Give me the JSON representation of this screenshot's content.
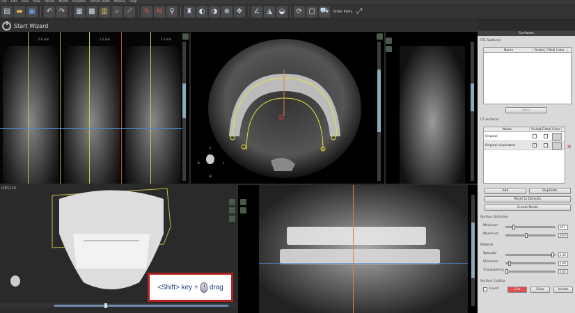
{
  "menu": [
    "File",
    "Edit",
    "Tools",
    "View",
    "Panels",
    "Model",
    "Implants",
    "Virtual Teeth",
    "Module",
    "Help"
  ],
  "toolbar": {
    "icons": [
      "new-file-icon",
      "open-folder-icon",
      "save-icon",
      "undo-icon",
      "redo-icon",
      "layout-icon",
      "grid-icon",
      "note-icon",
      "zoom-icon",
      "measure-icon",
      "pen-icon",
      "nerve-icon",
      "implant-icon",
      "crown-icon",
      "brightness-icon",
      "contrast-icon",
      "zoom-in-icon",
      "pan-icon",
      "angle-icon",
      "area-icon",
      "volume-icon",
      "rotate-icon",
      "screenshot-icon",
      "order-parts-icon",
      "expand-icon"
    ],
    "order_parts_label": "Order Parts"
  },
  "wizard": {
    "label": "Start Wizard"
  },
  "views": {
    "cross_section_labels": [
      "0.0 mm",
      "1.0 mm",
      "2.0 mm"
    ],
    "volume_title": "ICE1110",
    "axial_orientation": [
      "F",
      "L",
      "R",
      "B"
    ]
  },
  "hint": {
    "shift_key": "<Shift> key +",
    "drag": "drag"
  },
  "surfaces_panel": {
    "title": "Surfaces",
    "stl_group": "STL Surfaces",
    "stl_columns": [
      "Name",
      "Visible",
      "Filled",
      "Color"
    ],
    "apply_label": "Apply",
    "ct_group": "CT Surfaces",
    "ct_columns": [
      "Name",
      "Visible",
      "Filled",
      "Color"
    ],
    "ct_rows": [
      {
        "name": "Original",
        "visible": false,
        "filled": false
      },
      {
        "name": "Original duplicated",
        "visible": true,
        "filled": false
      }
    ],
    "add_label": "Add",
    "duplicate_label": "Duplicate",
    "reset_label": "Reset to Defaults",
    "create_model_label": "Create Model",
    "definition_group": "Surface Definition",
    "minimum_label": "Minimum",
    "minimum_value": "367",
    "maximum_label": "Maximum",
    "maximum_value": "2697",
    "material_group": "Material",
    "specular_label": "Specular",
    "specular_value": "1.00",
    "shininess_label": "Shininess",
    "shininess_value": "5.00",
    "transparency_label": "Transparency",
    "transparency_value": "0.00",
    "cutting_group": "Surface Cutting",
    "invert_label": "Invert",
    "cut_label": "Cut",
    "clear_label": "Clear",
    "isolate_label": "Isolate"
  }
}
